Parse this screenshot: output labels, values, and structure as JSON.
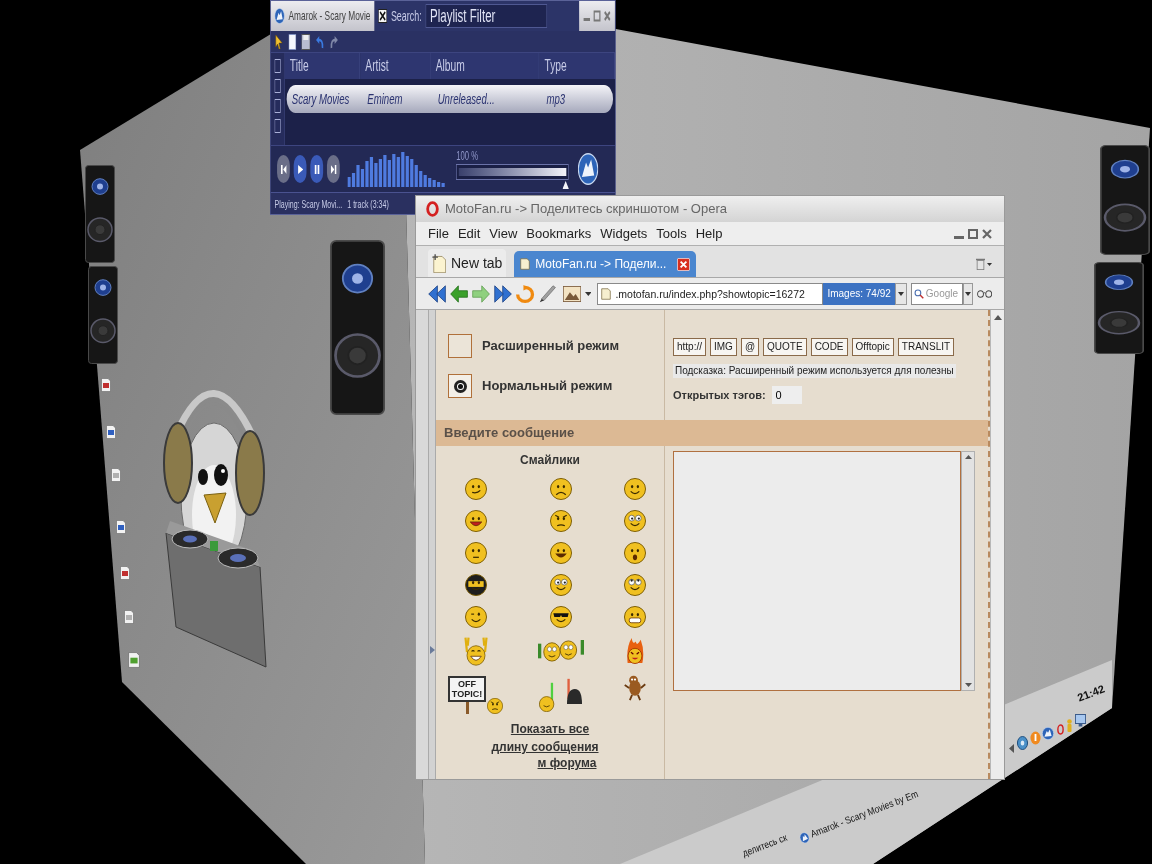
{
  "amarok": {
    "title": "Amarok - Scary Movie",
    "search_label": "Search:",
    "search": {
      "placeholder": "Playlist Filter"
    },
    "columns": [
      "Title",
      "Artist",
      "Album",
      "Type"
    ],
    "rows": [
      {
        "cells": [
          "Scary Movies",
          "Eminem",
          "Unreleased...",
          "mp3"
        ],
        "selected": true
      }
    ],
    "volume": {
      "reading": "100 %",
      "level": 1
    },
    "status_bar": [
      "Playing: Scary Movi...",
      "1 track (3:34)"
    ]
  },
  "opera": {
    "title": "MotoFan.ru -> Поделитесь скриншотом - Opera",
    "menu": [
      "File",
      "Edit",
      "View",
      "Bookmarks",
      "Widgets",
      "Tools",
      "Help"
    ],
    "new_tab": "New tab",
    "tabs": [
      {
        "label": "MotoFan.ru -> Подели...",
        "selected": true
      }
    ],
    "address": ".motofan.ru/index.php?showtopic=16272",
    "images_badge": "Images: 74/92",
    "search": {
      "placeholder": "Google"
    }
  },
  "page": {
    "modes": [
      {
        "label": "Расширенный режим",
        "selected": false
      },
      {
        "label": "Нормальный режим",
        "selected": true
      }
    ],
    "tag_buttons": [
      "http://",
      "IMG",
      "@",
      "QUOTE",
      "CODE",
      "Offtopic",
      "TRANSLIT"
    ],
    "hint": "Подсказка: Расширенный режим используется для полезны",
    "open_tags": {
      "label": "Открытых тэгов:",
      "value": "0"
    },
    "message_header": "Введите сообщение",
    "smilies_title": "Смайлики",
    "offtopic_sign": "OFF TOPIC!",
    "show_all": "Показать все",
    "links": [
      "длину сообщения",
      "м форума"
    ]
  },
  "taskbar": {
    "items": [
      {
        "label": "делитесь ск",
        "kind": "text"
      },
      {
        "label": "Amarok - Scary Movies by Em",
        "kind": "app"
      }
    ],
    "clock": "21:42"
  }
}
